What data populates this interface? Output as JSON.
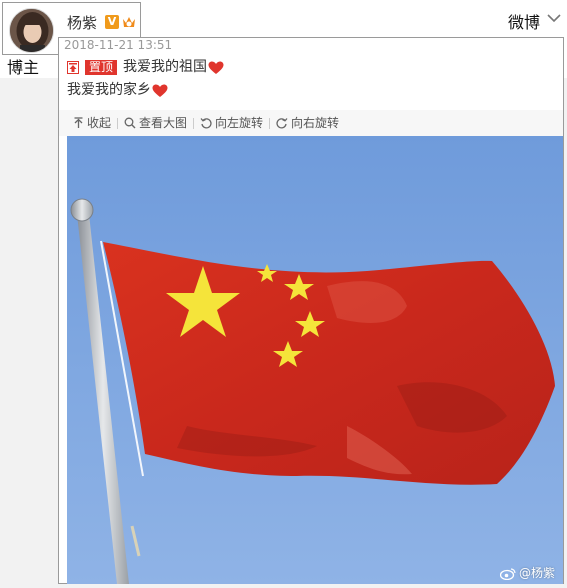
{
  "header": {
    "username": "杨紫",
    "verified_badge": "V",
    "brand": "微博",
    "role": "博主"
  },
  "post": {
    "timestamp": "2018-11-21 13:51",
    "pin_label": "置顶",
    "text_line1": "我爱我的祖国",
    "text_line2": "我爱我的家乡",
    "toolbar": {
      "collapse": "收起",
      "view_large": "查看大图",
      "rotate_left": "向左旋转",
      "rotate_right": "向右旋转"
    },
    "image": {
      "subject": "china-flag-photo",
      "watermark": "@杨紫"
    }
  },
  "colors": {
    "pin_red": "#e0352d",
    "badge_orange": "#f09a1b",
    "sky_blue": "#7ea6df",
    "flag_red": "#d62a1e",
    "star_yellow": "#f5e43a"
  },
  "icons": {
    "chevron": "chevron-down-icon",
    "pin": "pin-icon",
    "heart": "heart-icon",
    "collapse": "collapse-arrow-icon",
    "search": "search-icon",
    "rotate_left": "rotate-left-icon",
    "rotate_right": "rotate-right-icon",
    "weibo": "weibo-logo-icon"
  }
}
